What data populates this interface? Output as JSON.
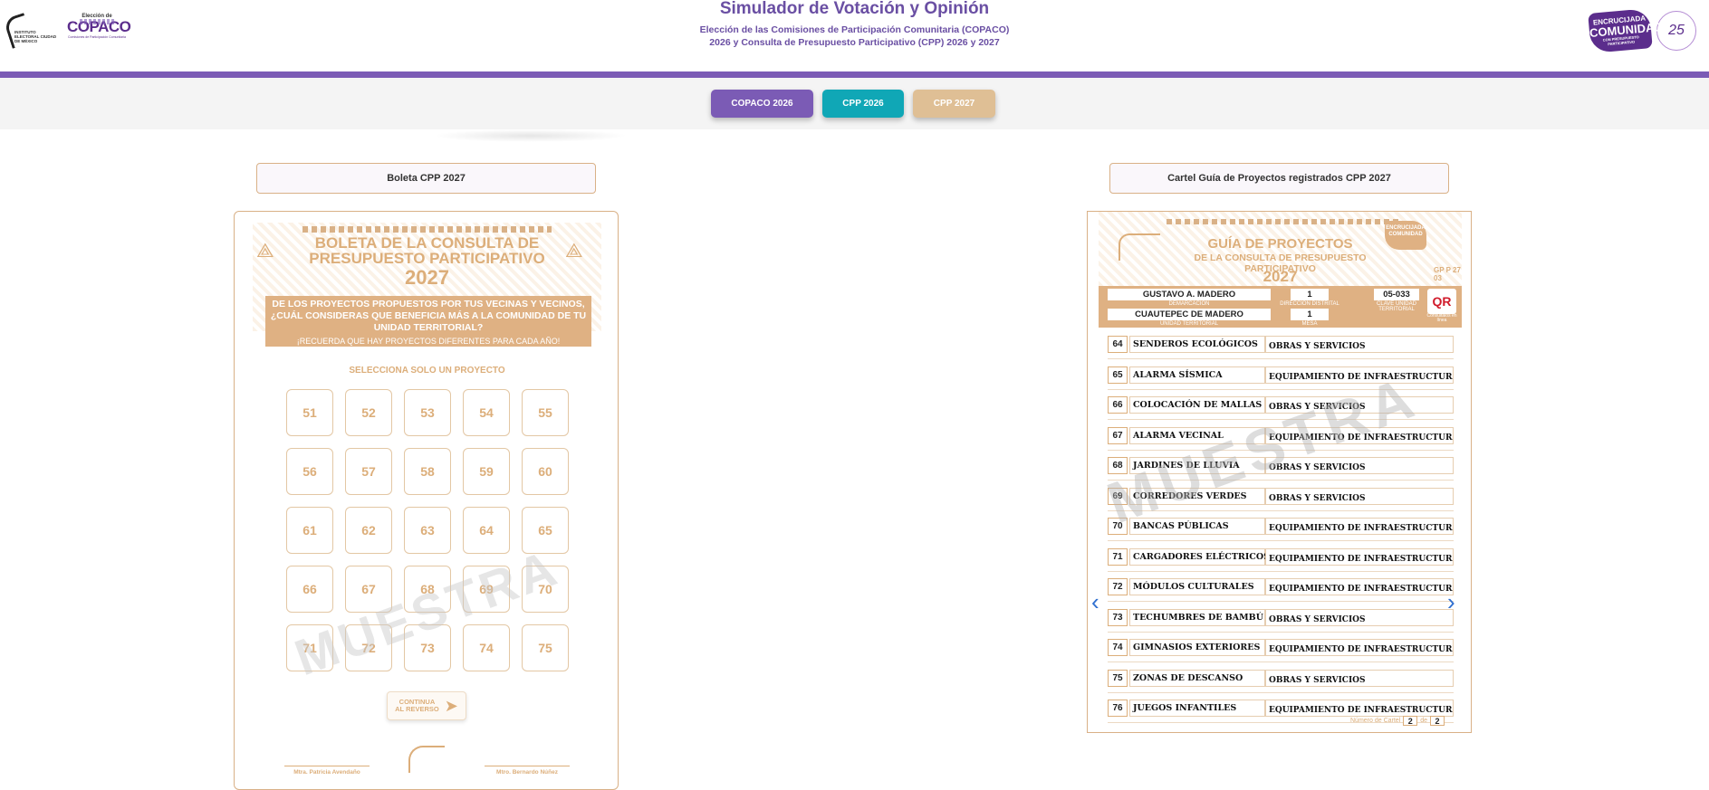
{
  "header": {
    "title": "Simulador de Votación y Opinión",
    "subtitle_line1": "Elección de las Comisiones de Participación Comunitaria (COPACO)",
    "subtitle_line2": "2026 y Consulta de Presupuesto Participativo (CPP) 2026 y 2027",
    "left_logo_iecm": "INSTITUTO ELECTORAL CIUDAD DE MÉXICO",
    "left_logo_eleccion": "Elección de",
    "left_logo_copaco": "COPACO",
    "left_logo_sub": "Comisiones de Participación Comunitaria",
    "right_logo_line1": "ENCRUCIJADA",
    "right_logo_line2": "COMUNIDAD",
    "right_logo_line3": "CON PRESUPUESTO PARTICIPATIVO",
    "right_logo_years": "25"
  },
  "tabs": [
    {
      "label": "COPACO 2026",
      "color": "#7b5bb5"
    },
    {
      "label": "CPP 2026",
      "color": "#10a7b6"
    },
    {
      "label": "CPP 2027",
      "color": "#dfbf95"
    }
  ],
  "left_panel": {
    "label": "Boleta CPP 2027",
    "ballot": {
      "title_line1": "BOLETA DE LA CONSULTA DE",
      "title_line2": "PRESUPUESTO PARTICIPATIVO",
      "year": "2027",
      "question": "DE LOS PROYECTOS PROPUESTOS POR TUS VECINAS Y VECINOS, ¿CUÁL CONSIDERAS QUE BENEFICIA MÁS A LA COMUNIDAD DE TU UNIDAD TERRITORIAL?",
      "reminder": "¡RECUERDA QUE HAY PROYECTOS DIFERENTES PARA CADA AÑO!",
      "instruction": "SELECCIONA SOLO UN PROYECTO",
      "options": [
        "51",
        "52",
        "53",
        "54",
        "55",
        "56",
        "57",
        "58",
        "59",
        "60",
        "61",
        "62",
        "63",
        "64",
        "65",
        "66",
        "67",
        "68",
        "69",
        "70",
        "71",
        "72",
        "73",
        "74",
        "75"
      ],
      "watermark": "MUESTRA",
      "continue_line1": "CONTINUA",
      "continue_line2": "AL REVERSO",
      "signature_left": "Mtra. Patricia Avendaño",
      "signature_right": "Mtro. Bernardo Núñez"
    }
  },
  "right_panel": {
    "label": "Cartel Guía de Proyectos registrados CPP 2027",
    "guide": {
      "title": "GUÍA DE PROYECTOS",
      "sub_line1": "DE LA CONSULTA DE PRESUPUESTO",
      "sub_line2": "PARTICIPATIVO",
      "year": "2027",
      "code": "GP P 27",
      "code2": "03",
      "enc_logo": "ENCRUCIJADA COMUNIDAD",
      "demarcacion": "GUSTAVO A. MADERO",
      "demarcacion_label": "DEMARCACIÓN",
      "unidad": "CUAUTEPEC DE MADERO",
      "unidad_label": "UNIDAD TERRITORIAL",
      "distrito": "1",
      "distrito_label": "DIRECCIÓN DISTRITAL",
      "mesa": "1",
      "mesa_label": "MESA",
      "clave": "05-033",
      "clave_label": "CLAVE UNIDAD TERRITORIAL",
      "qr": "QR",
      "qr_label": "Consúltalos en línea",
      "projects": [
        {
          "num": "64",
          "name": "SENDEROS ECOLÓGICOS",
          "category": "OBRAS Y SERVICIOS"
        },
        {
          "num": "65",
          "name": "ALARMA SÍSMICA",
          "category": "EQUIPAMIENTO DE INFRAESTRUCTURA"
        },
        {
          "num": "66",
          "name": "COLOCACIÓN DE MALLAS",
          "category": "OBRAS Y SERVICIOS"
        },
        {
          "num": "67",
          "name": "ALARMA VECINAL",
          "category": "EQUIPAMIENTO DE INFRAESTRUCTURA"
        },
        {
          "num": "68",
          "name": "JARDINES DE LLUVIA",
          "category": "OBRAS Y SERVICIOS"
        },
        {
          "num": "69",
          "name": "CORREDORES VERDES",
          "category": "OBRAS Y SERVICIOS"
        },
        {
          "num": "70",
          "name": "BANCAS PÚBLICAS",
          "category": "EQUIPAMIENTO DE INFRAESTRUCTURA"
        },
        {
          "num": "71",
          "name": "CARGADORES ELÉCTRICOS",
          "category": "EQUIPAMIENTO DE INFRAESTRUCTURA"
        },
        {
          "num": "72",
          "name": "MÓDULOS CULTURALES",
          "category": "EQUIPAMIENTO DE INFRAESTRUCTURA"
        },
        {
          "num": "73",
          "name": "TECHUMBRES DE BAMBÚ",
          "category": "OBRAS Y SERVICIOS"
        },
        {
          "num": "74",
          "name": "GIMNASIOS EXTERIORES",
          "category": "EQUIPAMIENTO DE INFRAESTRUCTURA"
        },
        {
          "num": "75",
          "name": "ZONAS DE DESCANSO",
          "category": "OBRAS Y SERVICIOS"
        },
        {
          "num": "76",
          "name": "JUEGOS INFANTILES",
          "category": "EQUIPAMIENTO DE INFRAESTRUCTURA"
        }
      ],
      "watermark": "MUESTRA",
      "footer_label": "Número de Cartel",
      "page_current": "2",
      "page_of": "de",
      "page_total": "2"
    },
    "prev_icon": "chevron-left-icon",
    "next_icon": "chevron-right-icon"
  },
  "colors": {
    "purple": "#7b5bb5",
    "teal": "#10a7b6",
    "sand": "#dfbf95",
    "ballot_accent": "#dcae7a"
  }
}
